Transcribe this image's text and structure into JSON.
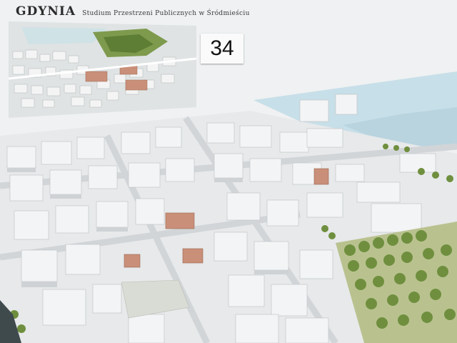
{
  "poster": {
    "title": "GDYNIA",
    "subtitle": "Studium Przestrzeni Publicznych w Śródmieściu",
    "sheet_number": "34"
  },
  "colors": {
    "background": "#eef0f1",
    "paper": "#f4f5f6",
    "sea": "#c5dde6",
    "building": "#e2e4e6",
    "building_shade": "#c9cccf",
    "roof_brick": "#c98f79",
    "greenery": "#6f8f3e",
    "park": "#b6bf8a"
  }
}
